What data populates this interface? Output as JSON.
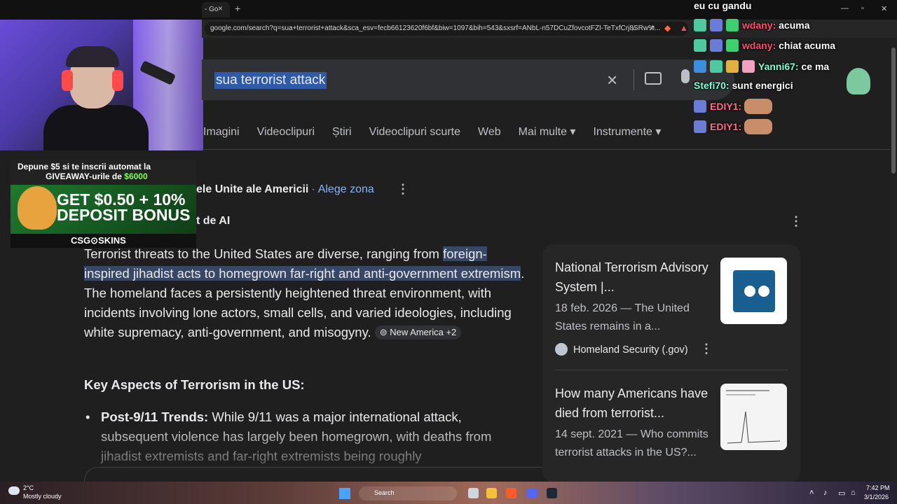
{
  "browser": {
    "tab_title": "- Go",
    "tab_close": "×",
    "new_tab": "+",
    "url": "google.com/search?q=sua+terrorist+attack&sca_esv=fecb66123620f6bf&biw=1097&bih=543&sxsrf=ANbL-n57DCuZfovcotFZI-TeTxfCrj8SRw%...",
    "window_controls": [
      "—",
      "▫",
      "✕"
    ]
  },
  "search": {
    "query": "sua terrorist attack",
    "clear_icon": "×",
    "nav": [
      "Imagini",
      "Videoclipuri",
      "Știri",
      "Videoclipuri scurte",
      "Web",
      "Mai multe ▾",
      "Instrumente ▾"
    ]
  },
  "location": {
    "text": "ele Unite ale Americii",
    "sep": "·",
    "link": "Alege zona"
  },
  "ai": {
    "label": "t de AI",
    "para_pre": "Terrorist threats to the United States are diverse, ranging from ",
    "para_hl": "foreign-inspired jihadist acts to homegrown far-right and anti-government extremism",
    "para_post": ". The homeland faces a persistently heightened threat environment, with incidents involving lone actors, small cells, and varied ideologies, including white supremacy, anti-government, and misogyny. ",
    "citation": "New America +2",
    "key_heading": "Key Aspects of Terrorism in the US:",
    "bullet_label": "Post-9/11 Trends:",
    "bullet_text": " While 9/11 was a major international attack, subsequent violence has largely been homegrown, with deaths from jihadist extremists and far-right extremists being roughly"
  },
  "sources": [
    {
      "title": "National Terrorism Advisory System |...",
      "snippet": "18 feb. 2026 — The United States remains in a...",
      "site": "Homeland Security (.gov)"
    },
    {
      "title": "How many Americans have died from terrorist...",
      "snippet": "14 sept. 2021 — Who commits terrorist attacks in the US?..."
    }
  ],
  "ad": {
    "line1": "Depune $5 si te inscrii automat la",
    "line2_pre": "GIVEAWAY-urile de ",
    "line2_amount": "$6000",
    "big1": "GET $0.50 + 10%",
    "big2": "DEPOSIT BONUS",
    "brand": "CSG⊙SKINS"
  },
  "chat": [
    {
      "user": "",
      "msg": "eu cu gandu",
      "color": "#ffffff"
    },
    {
      "user": "wdany:",
      "msg": "acuma",
      "color": "#ff4d6d"
    },
    {
      "user": "wdany:",
      "msg": "chiat acuma",
      "color": "#ff4d6d"
    },
    {
      "user": "Yanni67:",
      "msg": "ce ma",
      "color": "#7fffd4"
    },
    {
      "user": "Stefi70:",
      "msg": "sunt energici",
      "color": "#7fffd4"
    },
    {
      "user": "EDIY1:",
      "msg": "",
      "color": "#ff6b8a"
    },
    {
      "user": "EDIY1:",
      "msg": "",
      "color": "#ff6b8a"
    }
  ],
  "taskbar": {
    "temp": "2°C",
    "weather": "Mostly cloudy",
    "search_label": "Search",
    "time": "7:42 PM",
    "date": "3/1/2026"
  },
  "colors": {
    "page_bg": "#1f1f1f",
    "link": "#8ab4f8",
    "highlight": "#394766"
  }
}
